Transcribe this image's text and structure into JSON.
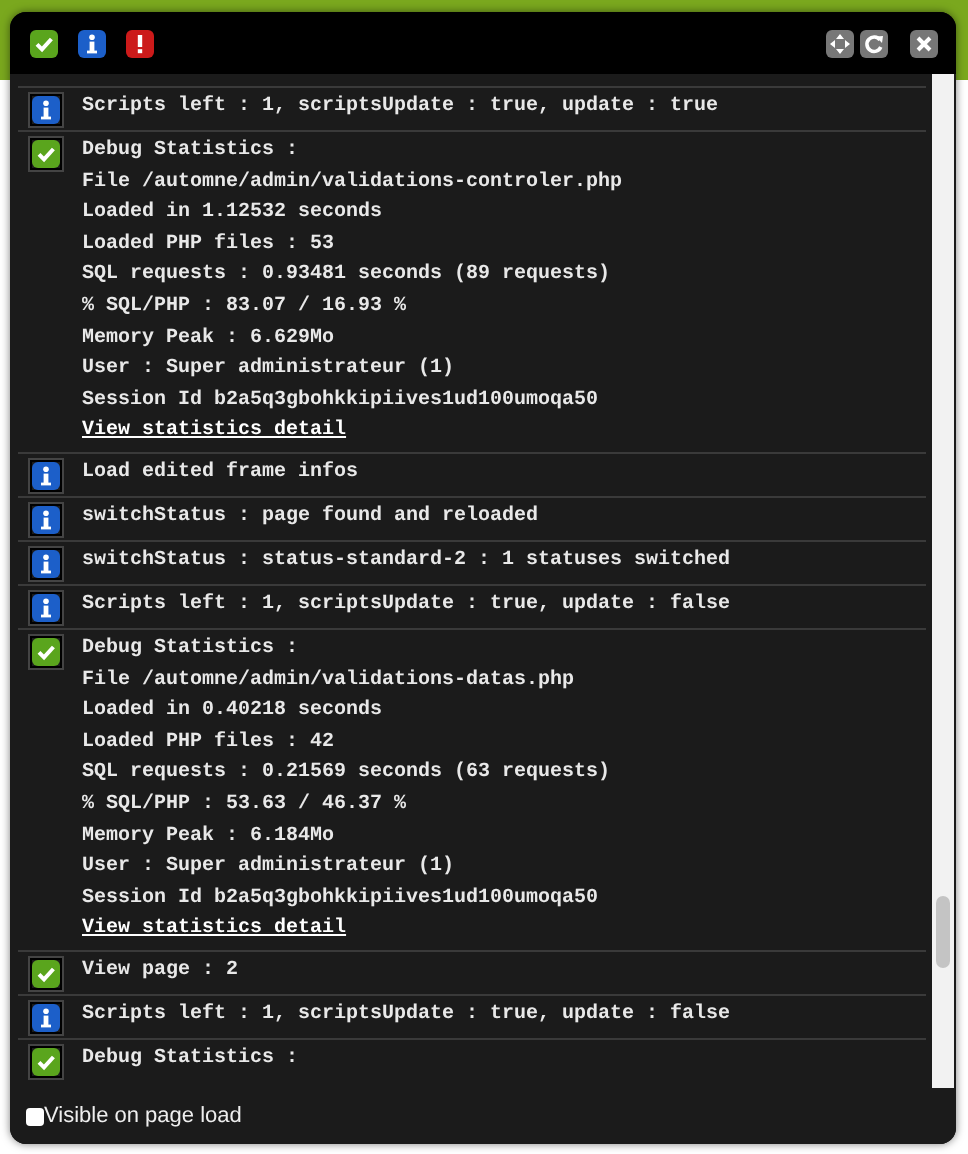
{
  "toolbar": {
    "filters": [
      {
        "kind": "success"
      },
      {
        "kind": "info"
      },
      {
        "kind": "error"
      }
    ]
  },
  "entries": [
    {
      "kind": "info",
      "lines": [
        "Scripts left : 1, scriptsUpdate : true, update : true"
      ]
    },
    {
      "kind": "success",
      "lines": [
        "Debug Statistics :",
        "File /automne/admin/validations-controler.php",
        "Loaded in 1.12532 seconds",
        "Loaded PHP files : 53",
        "SQL requests : 0.93481 seconds (89 requests)",
        "% SQL/PHP : 83.07 / 16.93 %",
        "Memory Peak : 6.629Mo",
        "User : Super administrateur (1)",
        "Session Id b2a5q3gbohkkipiives1ud100umoqa50"
      ],
      "link": "View statistics detail"
    },
    {
      "kind": "info",
      "lines": [
        "Load edited frame infos"
      ]
    },
    {
      "kind": "info",
      "lines": [
        "switchStatus : page found and reloaded"
      ]
    },
    {
      "kind": "info",
      "lines": [
        "switchStatus : status-standard-2 : 1 statuses switched"
      ]
    },
    {
      "kind": "info",
      "lines": [
        "Scripts left : 1, scriptsUpdate : true, update : false"
      ]
    },
    {
      "kind": "success",
      "lines": [
        "Debug Statistics :",
        "File /automne/admin/validations-datas.php",
        "Loaded in 0.40218 seconds",
        "Loaded PHP files : 42",
        "SQL requests : 0.21569 seconds (63 requests)",
        "% SQL/PHP : 53.63 / 46.37 %",
        "Memory Peak : 6.184Mo",
        "User : Super administrateur (1)",
        "Session Id b2a5q3gbohkkipiives1ud100umoqa50"
      ],
      "link": "View statistics detail"
    },
    {
      "kind": "success",
      "lines": [
        "View page : 2"
      ]
    },
    {
      "kind": "info",
      "lines": [
        "Scripts left : 1, scriptsUpdate : true, update : false"
      ]
    },
    {
      "kind": "success",
      "lines": [
        "Debug Statistics :"
      ]
    }
  ],
  "footer": {
    "checkbox": {
      "label": "Visible on page load",
      "checked": false
    }
  }
}
